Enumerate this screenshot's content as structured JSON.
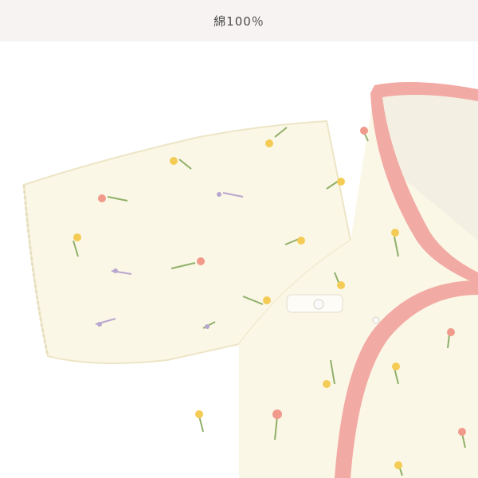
{
  "header": {
    "label": "綿100％"
  },
  "photo": {
    "subject": "garment-closeup-icon",
    "colors": {
      "fabric": "#fbf7e6",
      "fabric_shadow": "#efe9cf",
      "trim": "#f2aaa4",
      "trim_dark": "#e9928c",
      "background": "#ffffff",
      "header_bg": "#f6f3f2",
      "flower_pink": "#f19a8c",
      "flower_yellow": "#f4cc55",
      "flower_lavender": "#b7a6cf",
      "stem": "#8fb06a"
    }
  }
}
